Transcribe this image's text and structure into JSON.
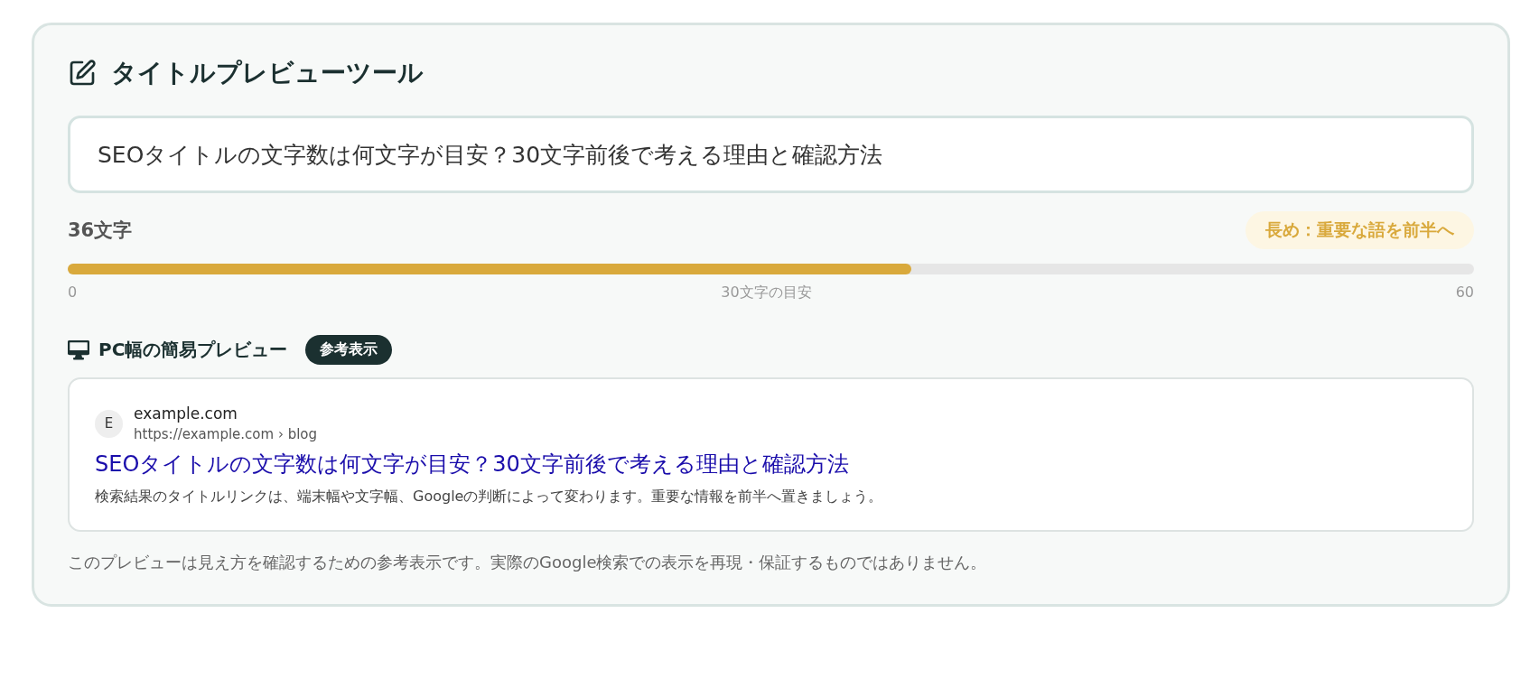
{
  "tool": {
    "title": "タイトルプレビューツール",
    "title_input": {
      "value": "SEOタイトルの文字数は何文字が目安？30文字前後で考える理由と確認方法"
    },
    "count": "36文字",
    "status_badge": "長め：重要な語を前半へ",
    "meter": {
      "level": 0.6,
      "min_label": "0",
      "mid_label": "30文字の目安",
      "max_label": "60"
    },
    "preview": {
      "heading": "PC幅の簡易プレビュー",
      "tag": "参考表示",
      "result": {
        "favicon_letter": "E",
        "site_name": "example.com",
        "url": "https://example.com › blog",
        "title": "SEOタイトルの文字数は何文字が目安？30文字前後で考える理由と確認方法",
        "snippet": "検索結果のタイトルリンクは、端末幅や文字幅、Googleの判断によって変わります。重要な情報を前半へ置きましょう。"
      }
    },
    "note": "このプレビューは見え方を確認するための参考表示です。実際のGoogle検索での表示を再現・保証するものではありません。"
  }
}
